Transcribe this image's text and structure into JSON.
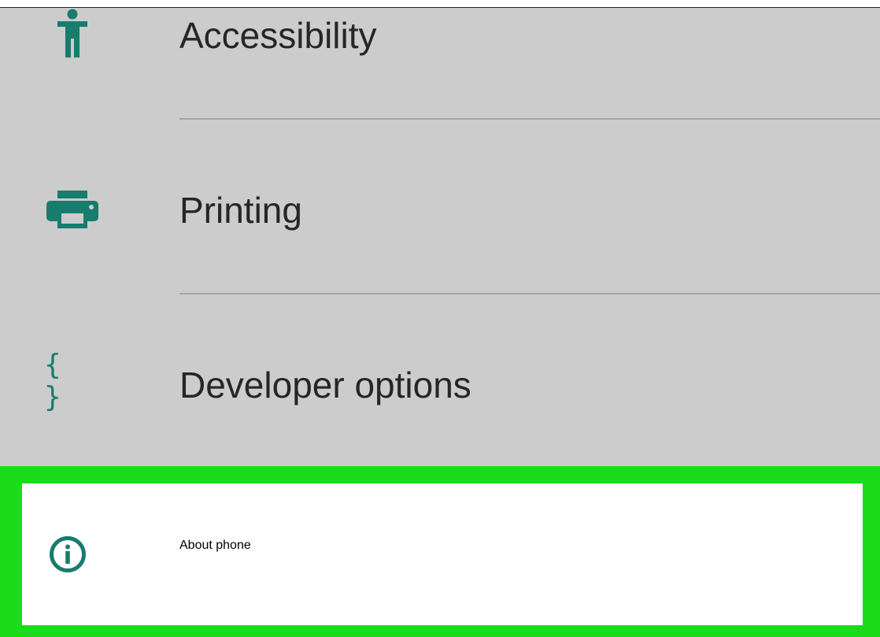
{
  "settings_list": {
    "items": [
      {
        "label": "Accessibility",
        "icon": "accessibility-icon"
      },
      {
        "label": "Printing",
        "icon": "printer-icon"
      },
      {
        "label": "Developer options",
        "icon": "braces-icon",
        "glyph": "{ }"
      },
      {
        "label": "About phone",
        "icon": "info-icon",
        "highlighted": true
      }
    ]
  },
  "colors": {
    "icon_teal": "#187c6e",
    "highlight_green": "#1bdc1b",
    "background_gray": "#cccccc"
  }
}
